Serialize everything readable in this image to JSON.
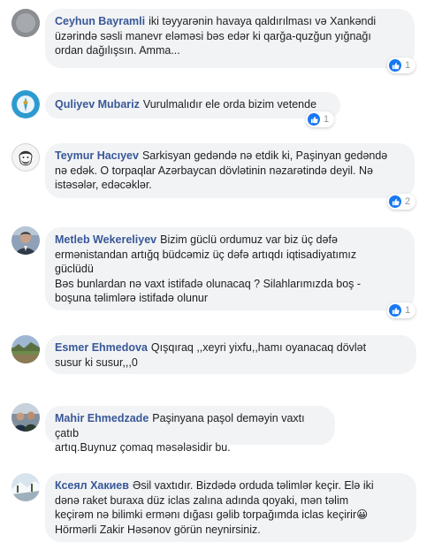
{
  "comments": [
    {
      "author": "Ceyhun Bayramli",
      "text": "iki təyyarənin havaya qaldırılması və Xankəndi\nüzərində səsli manevr eləməsi bəs edər ki qarğa-quzğun yığnağı\nordan dağılışsın. Amma...",
      "likes": "1",
      "avatar": "gray-circle"
    },
    {
      "author": "Quliyev Mubariz",
      "text": "Vurulmalıdır ele orda bizim vetende",
      "likes": "1",
      "avatar": "emblem"
    },
    {
      "author": "Teymur Hacıyev",
      "text": "Sarkisyan gedəndə nə etdik ki, Paşinyan gedəndə\nnə edək. O torpaqlar Azərbaycan dövlətinin nəzarətində deyil. Nə\nistəsələr, edəcəklər.",
      "likes": "2",
      "avatar": "man-sketch"
    },
    {
      "author": "Metleb Wekereliyev",
      "text": "Bizim güclü ordumuz var biz üç dəfə\nermənistandan artığq büdcəmiz üç dəfə artıqdı iqtisadiyatımız\ngüclüdü\nBəs bunlardan nə vaxt istifadə olunacaq ? Silahlarımızda boş -\nboşuna təlimlərə istifadə olunur",
      "likes": "1",
      "avatar": "photo-man"
    },
    {
      "author": "Esmer Ehmedova",
      "text": "Qışqıraq ,,xeyri yixfu,,hamı oyanacaq dövlət\nsusur ki susur,,,0",
      "likes": "",
      "avatar": "landscape"
    },
    {
      "author": "Mahir Ehmedzade",
      "text": "Paşinyana paşol deməyin vaxtı çatıb\nartıq.Buynuz çomaq məsələsidir bu.",
      "likes": "",
      "avatar": "group-photo"
    },
    {
      "author": "Ксеял Хакиев",
      "text": "Əsil vaxtıdır. Bizdədə orduda təlimlər keçir. Elə iki\ndənə raket buraxa düz iclas zalına adında qoyaki, mən təlim\nkeçirəm nə bilimki ermənı dığası gəlib torpağımda iclas keçirir😀\nHörmərli Zakir Həsənov görün neynirsiniz.",
      "likes": "",
      "avatar": "snow-landscape"
    }
  ],
  "colors": {
    "author": "#385898",
    "bubble": "#f2f3f5",
    "like": "#1877f2",
    "text": "#1c1e21"
  }
}
